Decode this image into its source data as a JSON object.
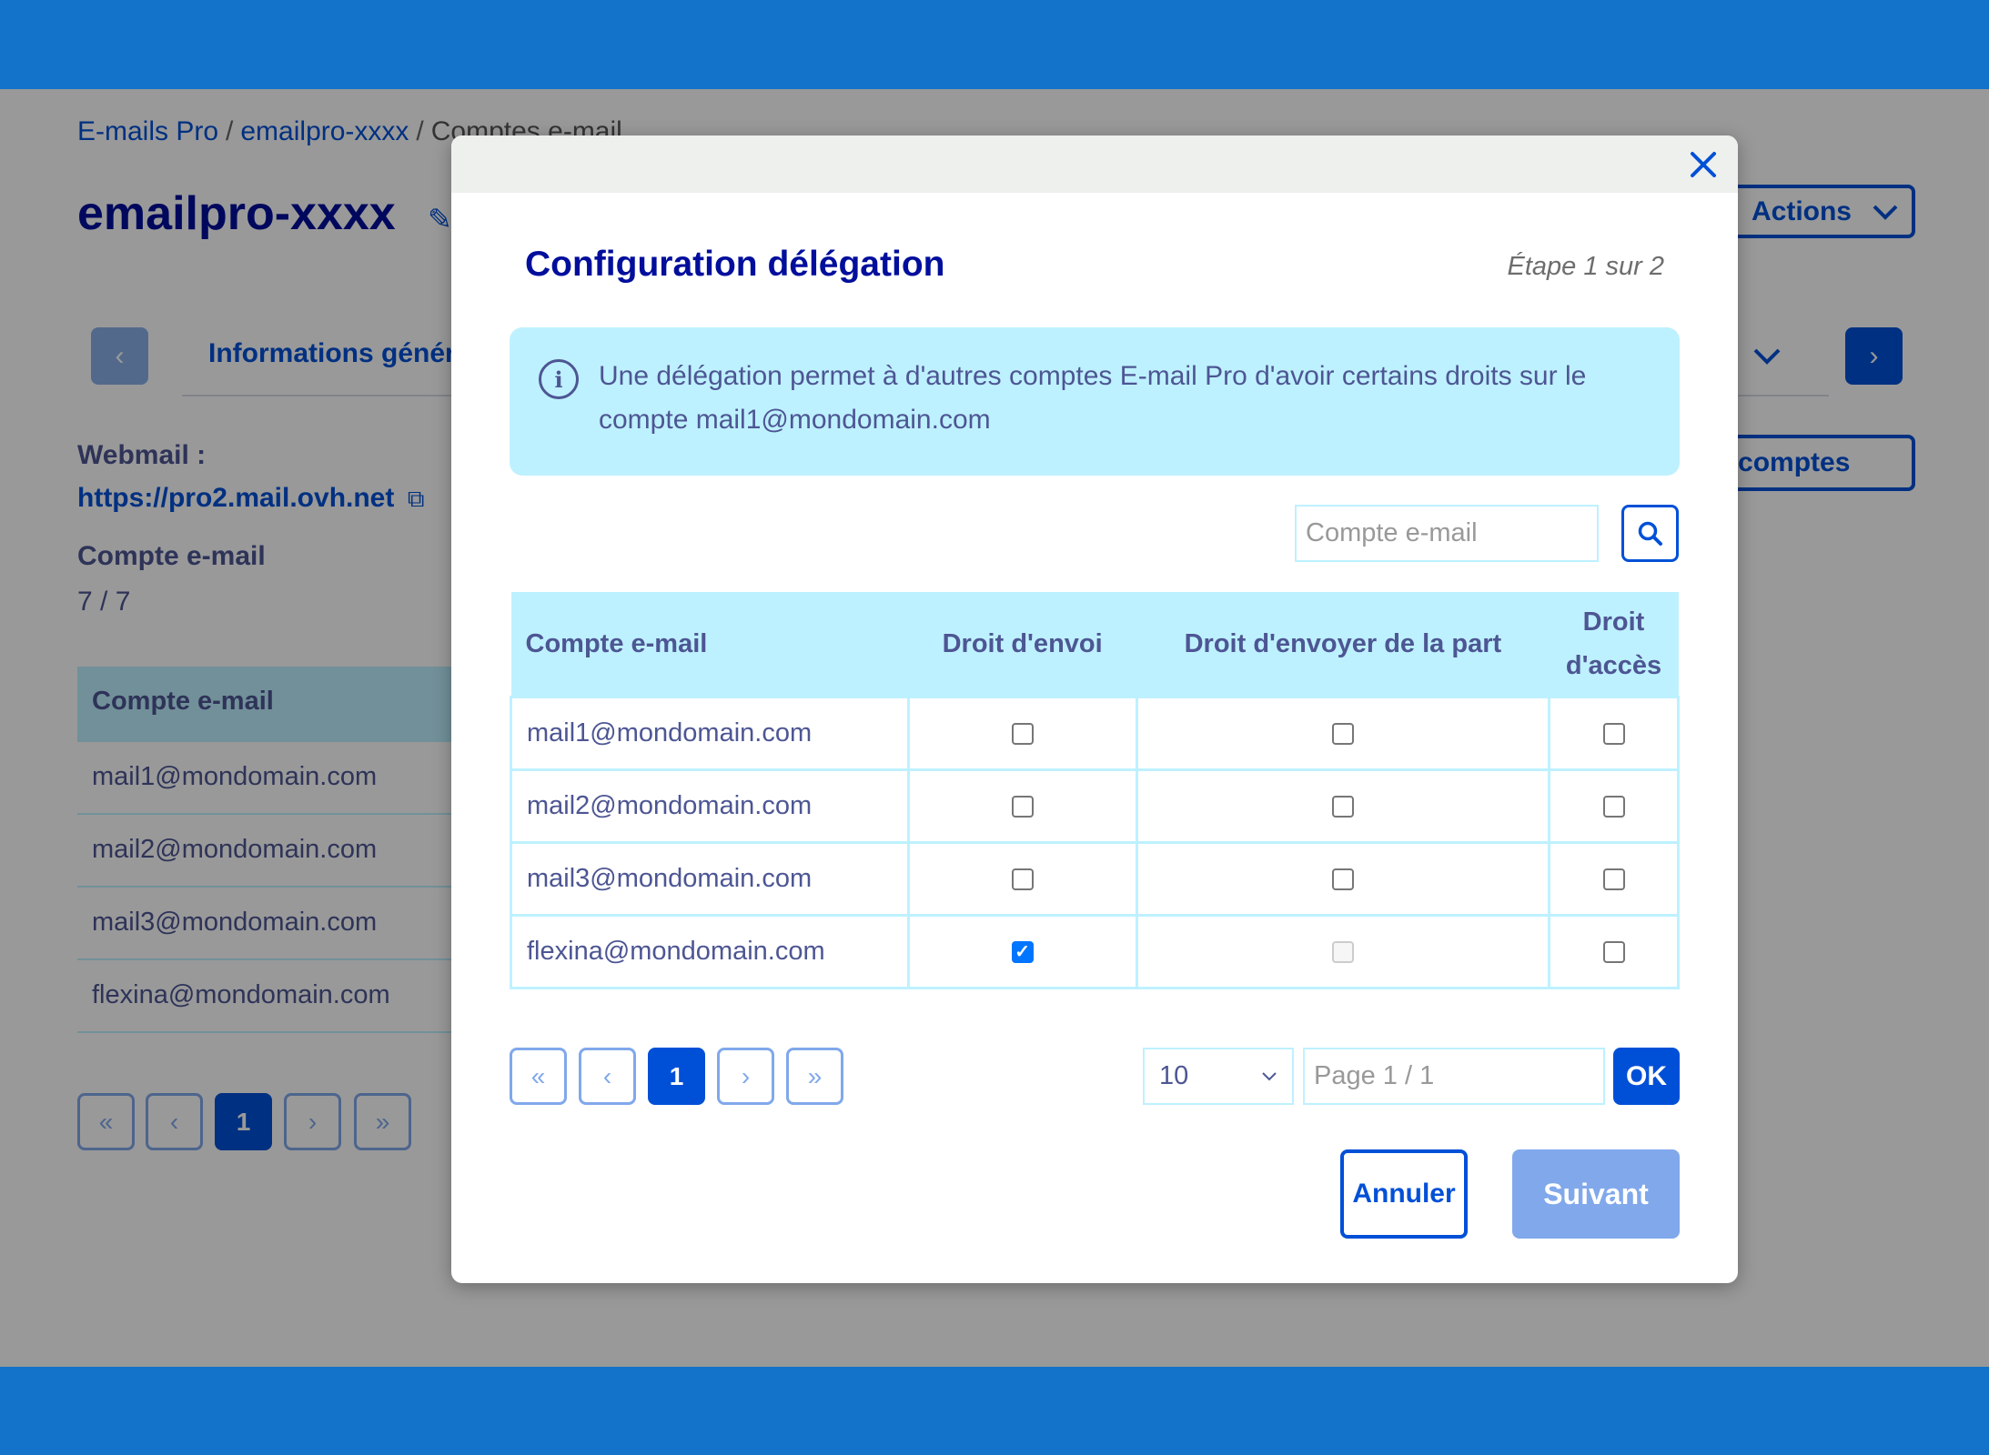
{
  "colors": {
    "primary": "#0050d7",
    "header_bar": "#1372c9",
    "info_bg": "#bef1ff",
    "disabled_button": "#80a8eb"
  },
  "breadcrumb": [
    "E-mails Pro",
    "emailpro-xxxx",
    "Comptes e-mail"
  ],
  "page": {
    "title": "emailpro-xxxx",
    "actions_label": "Actions",
    "tab_label": "Informations générales",
    "accounts_button_label": "Gérer les comptes",
    "webmail_label": "Webmail :",
    "webmail_link": "https://pro2.mail.ovh.net",
    "account_label": "Compte e-mail",
    "account_count": "7 / 7",
    "table_header": "Compte e-mail",
    "rows": [
      "mail1@mondomain.com",
      "mail2@mondomain.com",
      "mail3@mondomain.com",
      "flexina@mondomain.com"
    ],
    "pagination": {
      "first": "«",
      "prev": "‹",
      "current": "1",
      "next": "›",
      "last": "»"
    }
  },
  "modal": {
    "title": "Configuration délégation",
    "step": "Étape 1 sur 2",
    "info_icon": "info-circle-icon",
    "info_text": "Une délégation permet à d'autres comptes E-mail Pro d'avoir certains droits sur le compte mail1@mondomain.com",
    "search_placeholder": "Compte e-mail",
    "columns": [
      "Compte e-mail",
      "Droit d'envoi",
      "Droit d'envoyer de la part",
      "Droit d'accès"
    ],
    "rows": [
      {
        "email": "mail1@mondomain.com",
        "send": false,
        "send_on_behalf": false,
        "access": false,
        "send_on_behalf_disabled": false
      },
      {
        "email": "mail2@mondomain.com",
        "send": false,
        "send_on_behalf": false,
        "access": false,
        "send_on_behalf_disabled": false
      },
      {
        "email": "mail3@mondomain.com",
        "send": false,
        "send_on_behalf": false,
        "access": false,
        "send_on_behalf_disabled": false
      },
      {
        "email": "flexina@mondomain.com",
        "send": true,
        "send_on_behalf": false,
        "access": false,
        "send_on_behalf_disabled": true
      }
    ],
    "pagination": {
      "first": "«",
      "prev": "‹",
      "current": "1",
      "next": "›",
      "last": "»",
      "page_size": "10",
      "page_placeholder": "Page 1 / 1",
      "ok_label": "OK"
    },
    "cancel_label": "Annuler",
    "next_label": "Suivant"
  }
}
